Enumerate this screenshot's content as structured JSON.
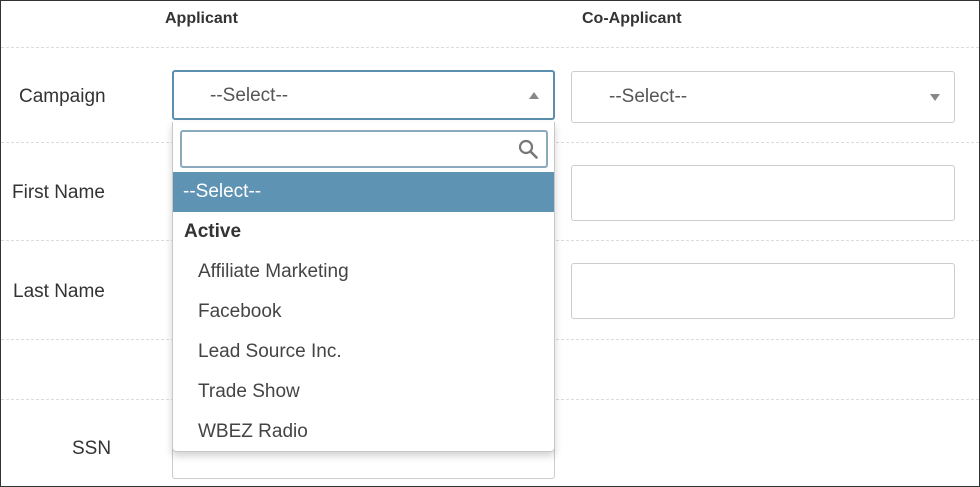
{
  "columns": {
    "applicant": "Applicant",
    "co_applicant": "Co-Applicant"
  },
  "rows": {
    "campaign": "Campaign",
    "first_name": "First Name",
    "last_name": "Last Name",
    "ssn": "SSN"
  },
  "campaign": {
    "applicant_value": "--Select--",
    "co_applicant_value": "--Select--"
  },
  "dropdown": {
    "search_value": "",
    "selected_item": "--Select--",
    "group_label": "Active",
    "options": [
      "Affiliate Marketing",
      "Facebook",
      "Lead Source Inc.",
      "Trade Show",
      "WBEZ Radio"
    ]
  },
  "colors": {
    "selected_bg": "#5e93b3",
    "focus_border": "#5b8fb0"
  }
}
